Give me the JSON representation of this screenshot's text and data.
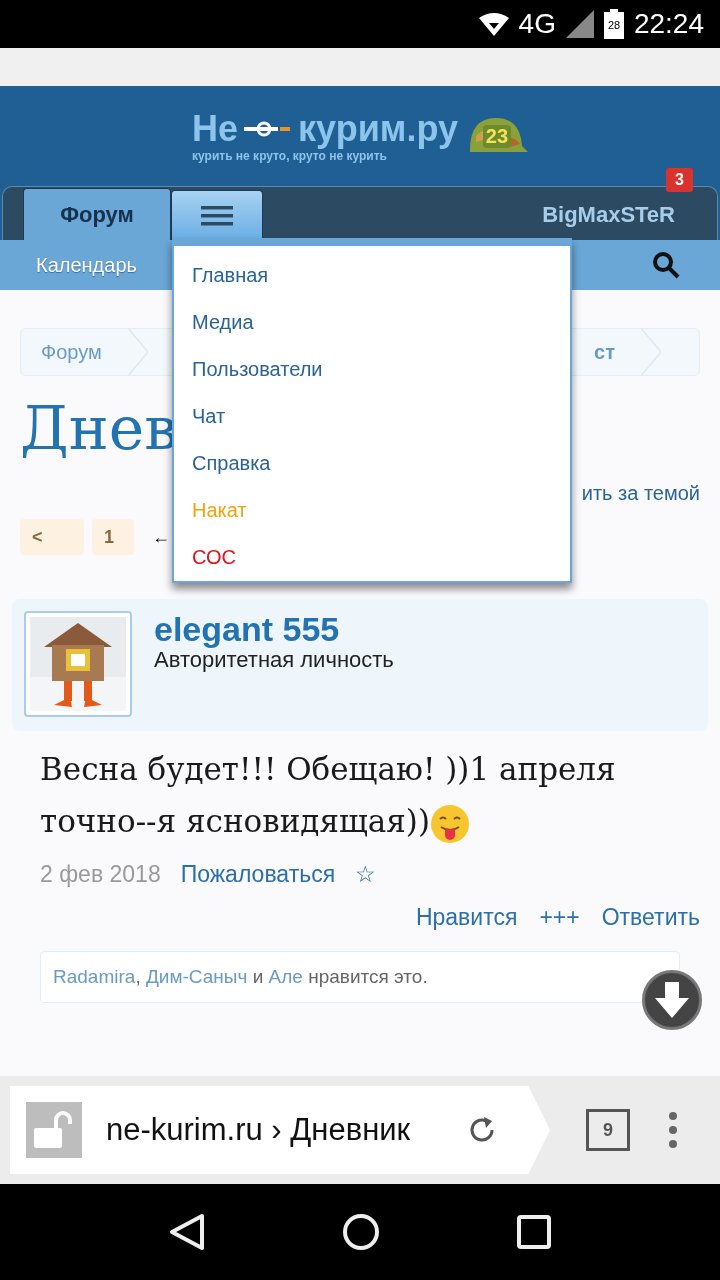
{
  "status_bar": {
    "network": "4G",
    "battery": "28",
    "time": "22:24"
  },
  "logo": {
    "part_1": "Не",
    "part_2": "курим.ру",
    "tagline": "курить не круто, круто не курить",
    "helmet_number": "23"
  },
  "tabs": [
    {
      "label": "Форум",
      "kind": "text",
      "selected": true
    },
    {
      "kind": "menu",
      "selected": false
    }
  ],
  "user": {
    "name": "BigMaxSTeR",
    "badge": "3"
  },
  "sub_nav": {
    "label": "Календарь"
  },
  "breadcrumb": [
    {
      "label": "Форум",
      "bold": false
    },
    {
      "label": "ст",
      "bold": true
    }
  ],
  "title": "Днев",
  "watch_link": "ить за темой",
  "pagination": {
    "prev": "<",
    "pages": [
      "1"
    ],
    "arrow": "←"
  },
  "menu": [
    {
      "label": "Главная",
      "color": "#2a6496"
    },
    {
      "label": "Медиа",
      "color": "#2a6496"
    },
    {
      "label": "Пользователи",
      "color": "#2a6496"
    },
    {
      "label": "Чат",
      "color": "#2a6496"
    },
    {
      "label": "Справка",
      "color": "#2a6496"
    },
    {
      "label": "Накат",
      "color": "#f0a30a"
    },
    {
      "label": "СОС",
      "color": "#e0141e"
    }
  ],
  "post": {
    "author": "elegant 555",
    "rank": "Авторитетная личность",
    "message": "Весна будет!!! Обещаю! ))1 апреля точно--я ясновидящая))",
    "date": "2 фев 2018",
    "report": "Пожаловаться",
    "star": "☆",
    "actions": [
      "Нравится",
      "+++",
      "Ответить"
    ],
    "likes": {
      "names": [
        "Radamira",
        "Дим-Саныч",
        "Але"
      ],
      "separator": ",",
      "conjunction": "и",
      "suffix": "нравится это."
    }
  },
  "browser": {
    "url": "ne-kurim.ru › Дневник",
    "tabs_count": "9"
  }
}
